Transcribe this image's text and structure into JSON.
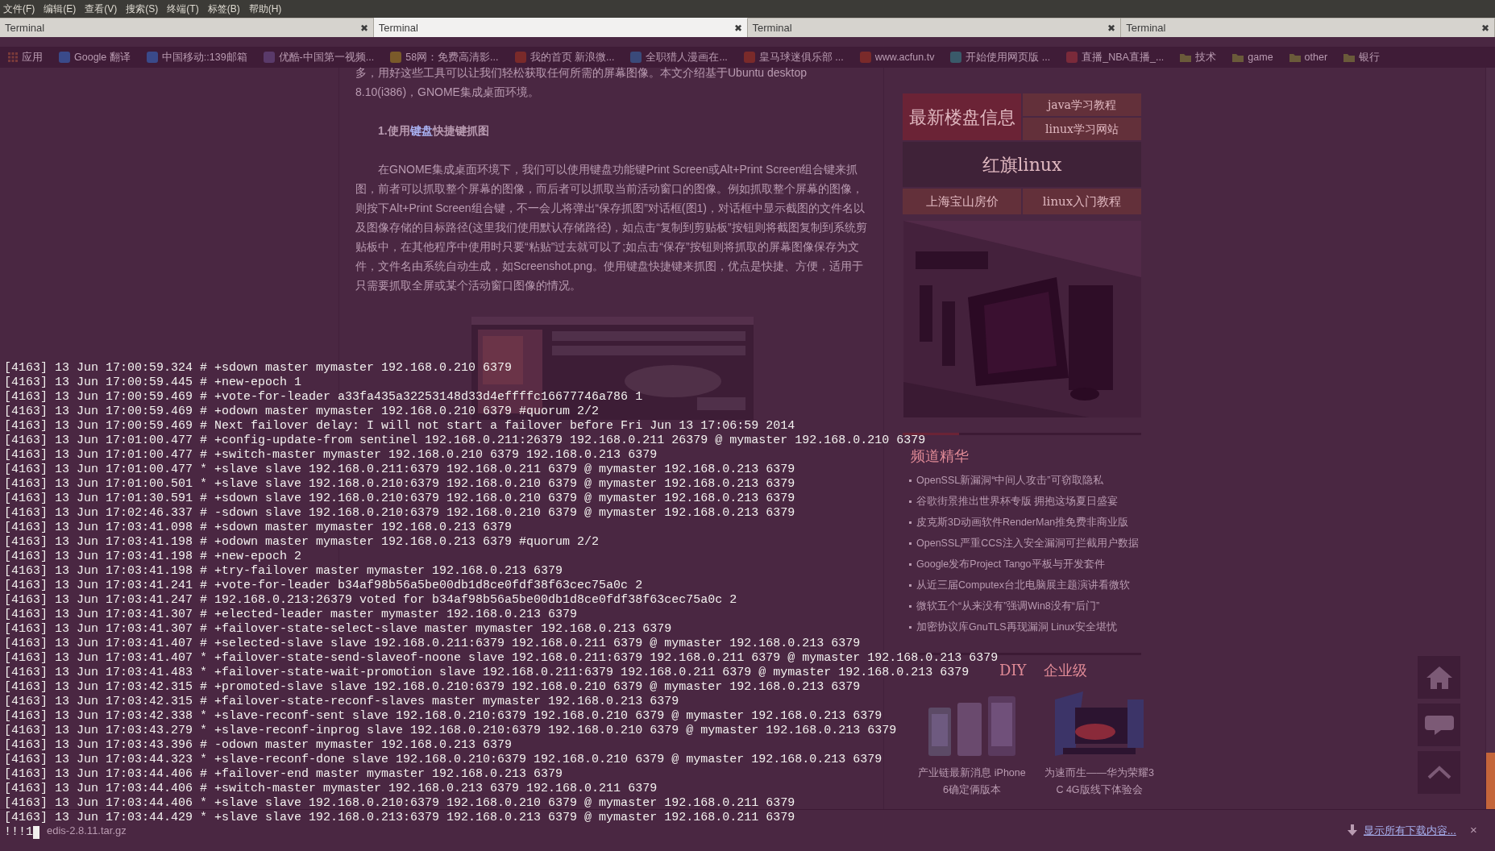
{
  "menu_bar": [
    "文件(F)",
    "编辑(E)",
    "查看(V)",
    "搜索(S)",
    "终端(T)",
    "标签(B)",
    "帮助(H)"
  ],
  "tabs": [
    {
      "title": "Terminal",
      "close": "✖",
      "selected": false
    },
    {
      "title": "Terminal",
      "close": "✖",
      "selected": true
    },
    {
      "title": "Terminal",
      "close": "✖",
      "selected": false
    },
    {
      "title": "Terminal",
      "close": "✖",
      "selected": false
    }
  ],
  "background_page": {
    "bookmarks": [
      {
        "label": "应用",
        "kind": "apps",
        "color": "#7a3a3a"
      },
      {
        "label": "Google 翻译",
        "kind": "site",
        "color": "#3a4a8a"
      },
      {
        "label": "中国移动::139邮箱",
        "kind": "site",
        "color": "#3a4a8a"
      },
      {
        "label": "优酷-中国第一视频...",
        "kind": "site",
        "color": "#5a3a6a"
      },
      {
        "label": "58网：免费高清影...",
        "kind": "site",
        "color": "#7a5a2a"
      },
      {
        "label": "我的首页 新浪微...",
        "kind": "site",
        "color": "#7a2a2a"
      },
      {
        "label": "全职猎人漫画在...",
        "kind": "site",
        "color": "#3a4a7a"
      },
      {
        "label": "皇马球迷俱乐部 ...",
        "kind": "site",
        "color": "#7a2a2a"
      },
      {
        "label": "www.acfun.tv",
        "kind": "site",
        "color": "#7a2a2a"
      },
      {
        "label": "开始使用网页版 ...",
        "kind": "site",
        "color": "#3a5a6a"
      },
      {
        "label": "直播_NBA直播_...",
        "kind": "site",
        "color": "#7a2a3a"
      },
      {
        "label": "技术",
        "kind": "folder",
        "color": "#6a5a3a"
      },
      {
        "label": "game",
        "kind": "folder",
        "color": "#6a5a3a"
      },
      {
        "label": "other",
        "kind": "folder",
        "color": "#6a5a3a"
      },
      {
        "label": "银行",
        "kind": "folder",
        "color": "#6a5a3a"
      }
    ],
    "article": {
      "intro": "多，用好这些工具可以让我们轻松获取任何所需的屏幕图像。本文介绍基于Ubuntu desktop 8.10(i386)，GNOME集成桌面环境。",
      "heading": {
        "before": "1.使用",
        "link": "键盘",
        "after": "快捷键抓图"
      },
      "paragraph": "在GNOME集成桌面环境下，我们可以使用键盘功能键Print Screen或Alt+Print Screen组合键来抓图，前者可以抓取整个屏幕的图像，而后者可以抓取当前活动窗口的图像。例如抓取整个屏幕的图像，则按下Alt+Print Screen组合键，不一会儿将弹出“保存抓图”对话框(图1)，对话框中显示截图的文件名以及图像存储的目标路径(这里我们使用默认存储路径)，如点击“复制到剪贴板”按钮则将截图复制到系统剪贴板中，在其他程序中使用时只要“粘贴”过去就可以了;如点击“保存”按钮则将抓取的屏幕图像保存为文件，文件名由系统自动生成，如Screenshot.png。使用键盘快捷键来抓图，优点是快捷、方便，适用于只需要抓取全屏或某个活动窗口图像的情况。"
    },
    "sidebar": {
      "ad_tiles": [
        {
          "label": "最新楼盘信息",
          "color": "#6b2336"
        },
        {
          "label": "java学习教程",
          "color": "#63303a"
        },
        {
          "label": "linux学习网站",
          "color": "#63303a"
        },
        {
          "label": "红旗linux",
          "color": "#3f2238"
        },
        {
          "label": "上海宝山房价",
          "color": "#63303a"
        },
        {
          "label": "linux入门教程",
          "color": "#63303a"
        }
      ],
      "section_title": "频道精华",
      "headlines": [
        "OpenSSL新漏洞“中间人攻击”可窃取隐私",
        "谷歌街景推出世界杯专版 拥抱这场夏日盛宴",
        "皮克斯3D动画软件RenderMan推免费非商业版",
        "OpenSSL严重CCS注入安全漏洞可拦截用户数据",
        "Google发布Project Tango平板与开发套件",
        "从近三届Computex台北电脑展主题演讲看微软",
        "微软五个“从来没有”强调Win8没有“后门”",
        "加密协议库GnuTLS再现漏洞 Linux安全堪忧"
      ],
      "category_tabs": [
        "DIY",
        "企业级"
      ],
      "products": [
        {
          "caption": "产业链最新消息 iPhone 6确定俩版本"
        },
        {
          "caption": "为速而生——华为荣耀3C 4G版线下体验会"
        }
      ]
    },
    "download_bar": {
      "file": "edis-2.8.11.tar.gz",
      "show_all": "显示所有下载内容...",
      "close": "×"
    }
  },
  "terminal": {
    "lines": [
      "[4163] 13 Jun 17:00:59.324 # +sdown master mymaster 192.168.0.210 6379",
      "[4163] 13 Jun 17:00:59.445 # +new-epoch 1",
      "[4163] 13 Jun 17:00:59.469 # +vote-for-leader a33fa435a32253148d33d4effffc16677746a786 1",
      "[4163] 13 Jun 17:00:59.469 # +odown master mymaster 192.168.0.210 6379 #quorum 2/2",
      "[4163] 13 Jun 17:00:59.469 # Next failover delay: I will not start a failover before Fri Jun 13 17:06:59 2014",
      "[4163] 13 Jun 17:01:00.477 # +config-update-from sentinel 192.168.0.211:26379 192.168.0.211 26379 @ mymaster 192.168.0.210 6379",
      "[4163] 13 Jun 17:01:00.477 # +switch-master mymaster 192.168.0.210 6379 192.168.0.213 6379",
      "[4163] 13 Jun 17:01:00.477 * +slave slave 192.168.0.211:6379 192.168.0.211 6379 @ mymaster 192.168.0.213 6379",
      "[4163] 13 Jun 17:01:00.501 * +slave slave 192.168.0.210:6379 192.168.0.210 6379 @ mymaster 192.168.0.213 6379",
      "[4163] 13 Jun 17:01:30.591 # +sdown slave 192.168.0.210:6379 192.168.0.210 6379 @ mymaster 192.168.0.213 6379",
      "[4163] 13 Jun 17:02:46.337 # -sdown slave 192.168.0.210:6379 192.168.0.210 6379 @ mymaster 192.168.0.213 6379",
      "[4163] 13 Jun 17:03:41.098 # +sdown master mymaster 192.168.0.213 6379",
      "[4163] 13 Jun 17:03:41.198 # +odown master mymaster 192.168.0.213 6379 #quorum 2/2",
      "[4163] 13 Jun 17:03:41.198 # +new-epoch 2",
      "[4163] 13 Jun 17:03:41.198 # +try-failover master mymaster 192.168.0.213 6379",
      "[4163] 13 Jun 17:03:41.241 # +vote-for-leader b34af98b56a5be00db1d8ce0fdf38f63cec75a0c 2",
      "[4163] 13 Jun 17:03:41.247 # 192.168.0.213:26379 voted for b34af98b56a5be00db1d8ce0fdf38f63cec75a0c 2",
      "[4163] 13 Jun 17:03:41.307 # +elected-leader master mymaster 192.168.0.213 6379",
      "[4163] 13 Jun 17:03:41.307 # +failover-state-select-slave master mymaster 192.168.0.213 6379",
      "[4163] 13 Jun 17:03:41.407 # +selected-slave slave 192.168.0.211:6379 192.168.0.211 6379 @ mymaster 192.168.0.213 6379",
      "[4163] 13 Jun 17:03:41.407 * +failover-state-send-slaveof-noone slave 192.168.0.211:6379 192.168.0.211 6379 @ mymaster 192.168.0.213 6379",
      "[4163] 13 Jun 17:03:41.483 * +failover-state-wait-promotion slave 192.168.0.211:6379 192.168.0.211 6379 @ mymaster 192.168.0.213 6379",
      "[4163] 13 Jun 17:03:42.315 # +promoted-slave slave 192.168.0.210:6379 192.168.0.210 6379 @ mymaster 192.168.0.213 6379",
      "[4163] 13 Jun 17:03:42.315 # +failover-state-reconf-slaves master mymaster 192.168.0.213 6379",
      "[4163] 13 Jun 17:03:42.338 * +slave-reconf-sent slave 192.168.0.210:6379 192.168.0.210 6379 @ mymaster 192.168.0.213 6379",
      "[4163] 13 Jun 17:03:43.279 * +slave-reconf-inprog slave 192.168.0.210:6379 192.168.0.210 6379 @ mymaster 192.168.0.213 6379",
      "[4163] 13 Jun 17:03:43.396 # -odown master mymaster 192.168.0.213 6379",
      "[4163] 13 Jun 17:03:44.323 * +slave-reconf-done slave 192.168.0.210:6379 192.168.0.210 6379 @ mymaster 192.168.0.213 6379",
      "[4163] 13 Jun 17:03:44.406 # +failover-end master mymaster 192.168.0.213 6379",
      "[4163] 13 Jun 17:03:44.406 # +switch-master mymaster 192.168.0.213 6379 192.168.0.211 6379",
      "[4163] 13 Jun 17:03:44.406 * +slave slave 192.168.0.210:6379 192.168.0.210 6379 @ mymaster 192.168.0.211 6379",
      "[4163] 13 Jun 17:03:44.429 * +slave slave 192.168.0.213:6379 192.168.0.213 6379 @ mymaster 192.168.0.211 6379"
    ],
    "prompt": "!!!1"
  }
}
